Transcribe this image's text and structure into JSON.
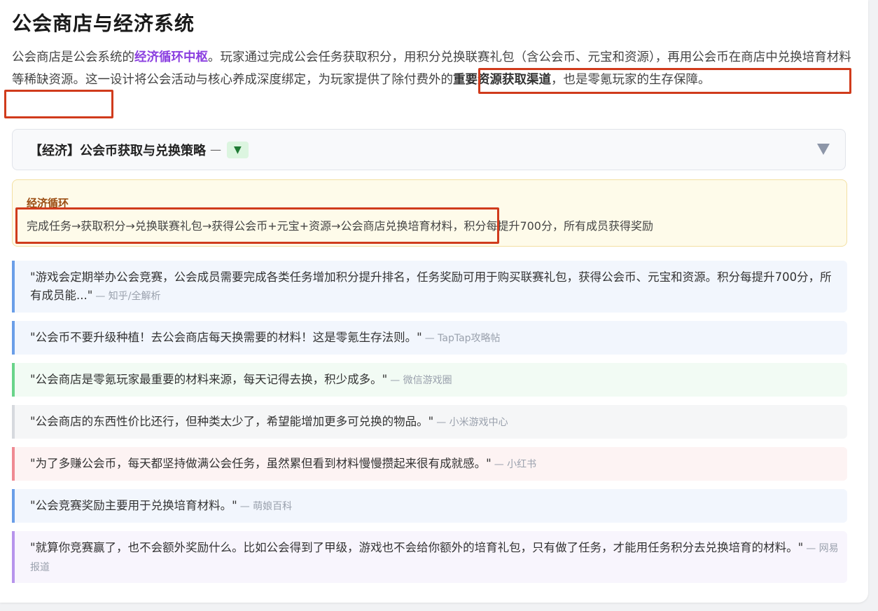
{
  "title": "公会商店与经济系统",
  "intro": {
    "p1": "公会商店是公会系统的",
    "p1_em": "经济循环中枢",
    "p2": "。玩家通过完成公会任务获取积分，用积分兑换联赛礼包（含公会币、元宝和资源），再用公会币在商店中兑换培育材料等稀缺资源。这一设计将公会活动与核心养成深度绑定，为玩家提供了除付费外的",
    "p2_em": "重要资源获取渠道",
    "p3": "，也是零氪玩家的生存保障。"
  },
  "accordion": {
    "label": "【经济】公会币获取与兑换策略",
    "dash": "—",
    "badge": "▼",
    "chevron": "chevron-down-icon"
  },
  "cycle": {
    "title": "经济循环",
    "text": "完成任务→获取积分→兑换联赛礼包→获得公会币+元宝+资源→公会商店兑换培育材料，积分每提升700分，所有成员获得奖励"
  },
  "quotes": [
    {
      "text": "\"游戏会定期举办公会竞赛，公会成员需要完成各类任务增加积分提升排名，任务奖励可用于购买联赛礼包，获得公会币、元宝和资源。积分每提升700分，所有成员能...\"",
      "source": "— 知乎/全解析",
      "accent": "#6a9ee8"
    },
    {
      "text": "\"公会币不要升级种植！去公会商店每天换需要的材料！这是零氪生存法则。\"",
      "source": "— TapTap攻略帖",
      "accent": "#6a9ee8"
    },
    {
      "text": "\"公会商店是零氪玩家最重要的材料来源，每天记得去换，积少成多。\"",
      "source": "— 微信游戏圈",
      "accent": "#69d48a"
    },
    {
      "text": "\"公会商店的东西性价比还行，但种类太少了，希望能增加更多可兑换的物品。\"",
      "source": "— 小米游戏中心",
      "accent": "#d6d9de"
    },
    {
      "text": "\"为了多赚公会币，每天都坚持做满公会任务，虽然累但看到材料慢慢攒起来很有成就感。\"",
      "source": "— 小红书",
      "accent": "#ef8a93"
    },
    {
      "text": "\"公会竞赛奖励主要用于兑换培育材料。\"",
      "source": "— 萌娘百科",
      "accent": "#6a9ee8"
    },
    {
      "text": "\"就算你竞赛赢了，也不会额外奖励什么。比如公会得到了甲级，游戏也不会给你额外的培育礼包，只有做了任务，才能用任务积分去兑换培育的材料。\"",
      "source": "— 网易报道",
      "accent": "#b794ec"
    }
  ]
}
